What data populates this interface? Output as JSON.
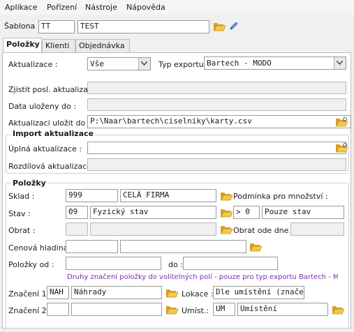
{
  "menu": [
    "Aplikace",
    "Pořízení",
    "Nástroje",
    "Nápověda"
  ],
  "template": {
    "label": "Šablona :",
    "code": "TT",
    "name": "TEST"
  },
  "tabs": [
    "Položky",
    "Klienti",
    "Objednávka"
  ],
  "export": {
    "update_label": "Aktualizace :",
    "update_value": "Vše",
    "type_label": "Typ exportu",
    "type_value": "Bartech - MODO",
    "last_update_label": "Zjistit posl. aktualizaci :",
    "last_update_value": "",
    "saved_label": "Data uloženy do :",
    "saved_value": "",
    "save_path_label": "Aktualizaci uložit do :",
    "save_path_value": "P:\\Naar\\bartech\\ciselniky\\karty.csv"
  },
  "import": {
    "title": "Import aktualizace",
    "full_label": "Úplná aktualizace :",
    "full_value": "",
    "diff_label": "Rozdílová aktualizace :",
    "diff_value": ""
  },
  "items": {
    "title": "Položky",
    "warehouse_label": "Sklad :",
    "warehouse_code": "999",
    "warehouse_name": "CELÁ FIRMA",
    "quantity_condition_label": "Podmínka pro množství :",
    "state_label": "Stav :",
    "state_code": "09",
    "state_name": "Fyzický stav",
    "condition_op": "> 0",
    "condition_value": "Pouze stav",
    "turnover_label": "Obrat :",
    "turnover_code": "",
    "turnover_name": "",
    "turnover_since_label": "Obrat ode dne :",
    "turnover_since_value": "",
    "price_label": "Cenová hladina :",
    "price_code": "",
    "price_name": "",
    "from_label": "Položky od :",
    "from_value": "",
    "to_label": "do :",
    "to_value": "",
    "hint": "Druhy značení položky do volitelných polí - pouze pro typ exportu Bartech - MODO",
    "mark1_label": "Značení 1 :",
    "mark1_code": "NAH",
    "mark1_name": "Náhrady",
    "location_label": "Lokace :",
    "location_value": "Dle umístění (značení)",
    "mark2_label": "Značení 2 :",
    "mark2_code": "",
    "mark2_name": "",
    "placement_label": "Umíst.:",
    "placement_code": "UM",
    "placement_name": "Umístění"
  },
  "colors": {
    "folder_icon": "#e7b22c",
    "hint_text": "#7b2fa8",
    "pencil_icon": "#3b6fb6"
  }
}
